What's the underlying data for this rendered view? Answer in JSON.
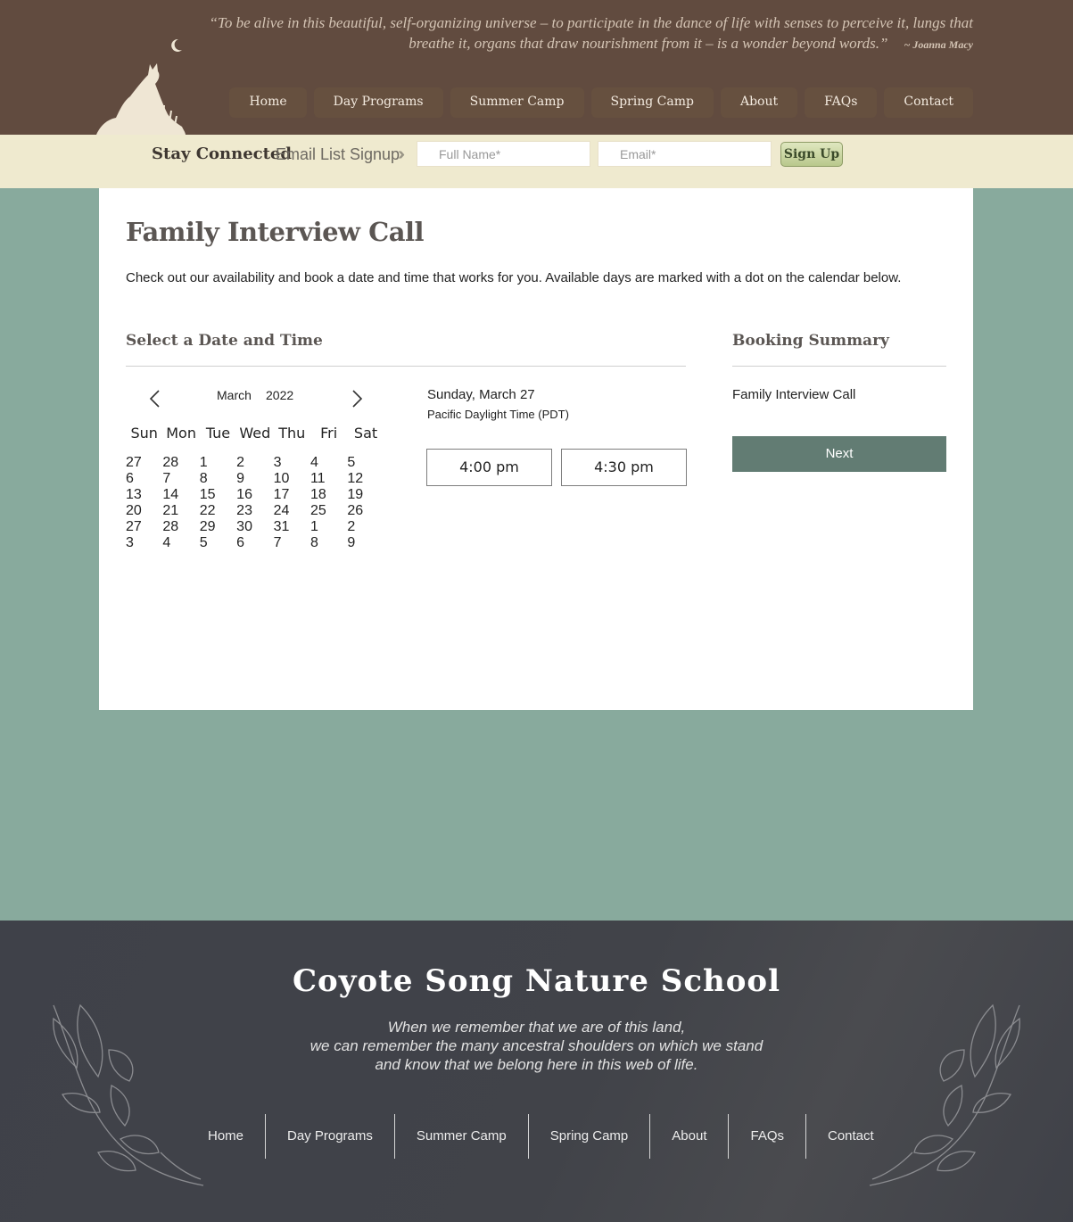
{
  "header": {
    "quote_line1": "“To be alive in this beautiful, self-organizing universe – to participate in the dance of life with senses to perceive it, lungs that",
    "quote_line2": "breathe it, organs that draw nourishment from it – is a wonder beyond words.”",
    "quote_author": "~ Joanna Macy",
    "nav": [
      "Home",
      "Day Programs",
      "Summer Camp",
      "Spring Camp",
      "About",
      "FAQs",
      "Contact"
    ]
  },
  "signup": {
    "stay_connected": "Stay Connected",
    "label": "Email List Signup",
    "name_placeholder": "Full Name*",
    "email_placeholder": "Email*",
    "button": "Sign Up"
  },
  "main": {
    "title": "Family Interview Call",
    "intro": "Check out our availability and book a date and time that works for you. Available days are marked with a dot on the calendar below.",
    "select_heading": "Select a Date and Time",
    "summary_heading": "Booking Summary",
    "calendar": {
      "month": "March",
      "year": "2022",
      "weekdays": [
        "Sun",
        "Mon",
        "Tue",
        "Wed",
        "Thu",
        "Fri",
        "Sat"
      ],
      "days": [
        {
          "d": "27",
          "muted": true
        },
        {
          "d": "28",
          "muted": true
        },
        {
          "d": "1"
        },
        {
          "d": "2"
        },
        {
          "d": "3"
        },
        {
          "d": "4"
        },
        {
          "d": "5"
        },
        {
          "d": "6"
        },
        {
          "d": "7"
        },
        {
          "d": "8"
        },
        {
          "d": "9"
        },
        {
          "d": "10"
        },
        {
          "d": "11"
        },
        {
          "d": "12"
        },
        {
          "d": "13"
        },
        {
          "d": "14"
        },
        {
          "d": "15"
        },
        {
          "d": "16"
        },
        {
          "d": "17"
        },
        {
          "d": "18"
        },
        {
          "d": "19"
        },
        {
          "d": "20"
        },
        {
          "d": "21"
        },
        {
          "d": "22"
        },
        {
          "d": "23"
        },
        {
          "d": "24"
        },
        {
          "d": "25"
        },
        {
          "d": "26"
        },
        {
          "d": "27",
          "selected": true
        },
        {
          "d": "28",
          "available": true
        },
        {
          "d": "29"
        },
        {
          "d": "30"
        },
        {
          "d": "31"
        },
        {
          "d": "1",
          "muted": true
        },
        {
          "d": "2",
          "muted": true
        },
        {
          "d": "3",
          "muted": true
        },
        {
          "d": "4",
          "muted": true
        },
        {
          "d": "5",
          "muted": true
        },
        {
          "d": "6",
          "muted": true
        },
        {
          "d": "7",
          "muted": true
        },
        {
          "d": "8",
          "muted": true
        },
        {
          "d": "9",
          "muted": true
        }
      ]
    },
    "selected_date": "Sunday, March 27",
    "timezone": "Pacific Daylight Time (PDT)",
    "slots": [
      "4:00 pm",
      "4:30 pm"
    ],
    "summary_item": "Family Interview Call",
    "next_button": "Next"
  },
  "footer": {
    "title": "Coyote Song Nature School",
    "quote_lines": [
      "When we remember that we are of this land,",
      "we can remember the many ancestral shoulders on which we stand",
      "and know that we belong here in this web of life."
    ],
    "nav": [
      "Home",
      "Day Programs",
      "Summer Camp",
      "Spring Camp",
      "About",
      "FAQs",
      "Contact"
    ]
  },
  "colors": {
    "header_bg": "#614b3f",
    "signup_bg": "#efeacf",
    "page_bg": "#88aa9d",
    "accent": "#5f7d70",
    "footer_bg": "#414349"
  },
  "icons": [
    "coyote-moon-logo",
    "chevron-left-icon",
    "chevron-right-icon",
    "double-chevron-icon",
    "leaf-branch-icon"
  ]
}
